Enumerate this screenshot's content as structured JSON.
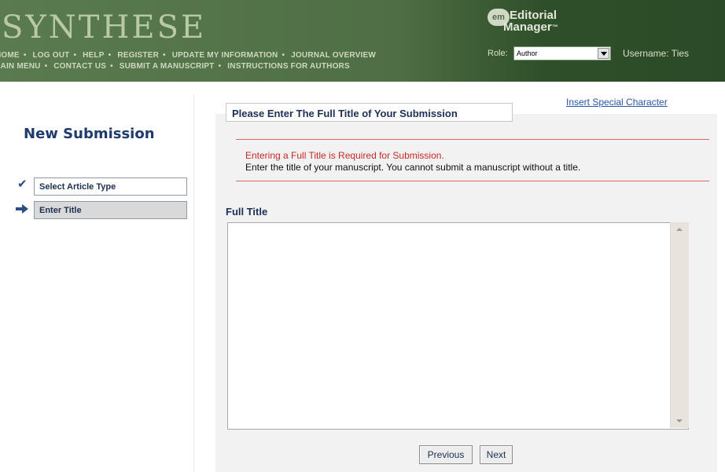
{
  "header": {
    "journal_title": "SYNTHESE",
    "nav_row1": [
      "HOME",
      "LOG OUT",
      "HELP",
      "REGISTER",
      "UPDATE MY INFORMATION",
      "JOURNAL OVERVIEW"
    ],
    "nav_row2": [
      "MAIN MENU",
      "CONTACT US",
      "SUBMIT A MANUSCRIPT",
      "INSTRUCTIONS FOR AUTHORS"
    ],
    "em_badge": "em",
    "em_line1": "Editorial",
    "em_line2": "Manager",
    "role_label": "Role:",
    "role_value": "Author",
    "username": "Username: Ties"
  },
  "sidebar": {
    "title": "New Submission",
    "steps": [
      {
        "label": "Select Article Type",
        "status": "completed",
        "icon": "check-icon"
      },
      {
        "label": "Enter Title",
        "status": "current",
        "icon": "arrow-right-icon"
      }
    ]
  },
  "main": {
    "panel_title": "Please Enter The Full Title of Your Submission",
    "insert_link": "Insert Special Character",
    "error_message": "Entering a Full Title is Required for Submission.",
    "info_message": "Enter the title of your manuscript. You cannot submit a manuscript without a title.",
    "field_label": "Full Title",
    "field_value": "",
    "previous_button": "Previous",
    "next_button": "Next"
  },
  "colors": {
    "header_green": "#4f6e45",
    "title_navy": "#1e3a6e",
    "error_red": "#c82626",
    "link_blue": "#2b55a8"
  }
}
